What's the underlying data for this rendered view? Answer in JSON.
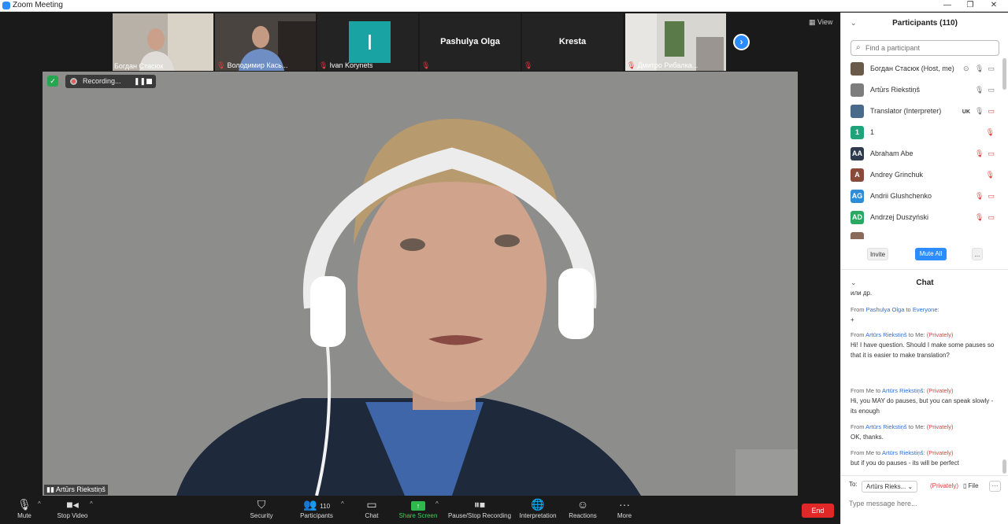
{
  "window": {
    "title": "Zoom Meeting",
    "minimize": "—",
    "maximize": "❐",
    "close": "✕"
  },
  "meeting": {
    "view_label": "View",
    "recording": {
      "label": "Recording...",
      "pause": "❚❚"
    },
    "speaker_name": "Artūrs Riekstiņš",
    "tiles": [
      {
        "name": "Богдан Стасюк",
        "muted": false
      },
      {
        "name": "Володимир Кась...",
        "muted": true
      },
      {
        "name": "Ivan Korynets",
        "muted": true,
        "letter": "I"
      },
      {
        "center_name": "Pashulya Olga",
        "muted": true
      },
      {
        "center_name": "Kresta",
        "muted": true
      },
      {
        "name": "Дмитро Рибалка...",
        "muted": true
      }
    ]
  },
  "toolbar": {
    "mute": "Mute",
    "stop_video": "Stop Video",
    "security": "Security",
    "participants": "Participants",
    "participants_count": "110",
    "chat": "Chat",
    "share_screen": "Share Screen",
    "pause_stop_recording": "Pause/Stop Recording",
    "interpretation": "Interpretation",
    "reactions": "Reactions",
    "more": "More",
    "end": "End"
  },
  "participants_panel": {
    "title": "Participants (110)",
    "search_placeholder": "Find a participant",
    "items": [
      {
        "name": "Богдан Стасюк (Host, me)",
        "avatar_color": "#6a5a4a",
        "avatar_text": ""
      },
      {
        "name": "Artūrs Riekstiņš",
        "avatar_color": "#7d7d7d",
        "avatar_text": ""
      },
      {
        "name": "Translator (Interpreter)",
        "avatar_color": "#4a6a8a",
        "avatar_text": "",
        "lang": "UK"
      },
      {
        "name": "1",
        "avatar_color": "#1fa37a",
        "avatar_text": "1"
      },
      {
        "name": "Abraham Abe",
        "avatar_color": "#2e3b4e",
        "avatar_text": "AA"
      },
      {
        "name": "Andrey Grinchuk",
        "avatar_color": "#8a4a3a",
        "avatar_text": "A"
      },
      {
        "name": "Andrii Glushchenko",
        "avatar_color": "#2d8cd6",
        "avatar_text": "AG"
      },
      {
        "name": "Andrzej Duszyński",
        "avatar_color": "#28a860",
        "avatar_text": "AD"
      }
    ],
    "invite": "Invite",
    "mute_all": "Mute All",
    "more": "..."
  },
  "chat_panel": {
    "title": "Chat",
    "messages": [
      {
        "text": "или др."
      },
      {
        "from": "Pashulya Olga",
        "to": "Everyone",
        "private": "",
        "text": "+"
      },
      {
        "from": "Artūrs Riekstiņš",
        "to": "Me",
        "private": "(Privately)",
        "text": "Hi! I have question. Should I make some pauses so that it is easier to make translation?"
      },
      {
        "from": "Me",
        "to": "Artūrs Riekstiņš",
        "private": "(Privately)",
        "text": "Hi, you MAY do pauses, but you can speak slowly - its enough"
      },
      {
        "from": "Artūrs Riekstiņš",
        "to": "Me",
        "private": "(Privately)",
        "text": "OK, thanks."
      },
      {
        "from": "Me",
        "to": "Artūrs Riekstiņš",
        "private": "(Privately)",
        "text": "but if you do pauses - its will be perfect"
      }
    ],
    "to_label": "To:",
    "to_value": "Artūrs Rieks...",
    "privately": "(Privately)",
    "file": "File",
    "more": "···",
    "input_placeholder": "Type message here..."
  }
}
